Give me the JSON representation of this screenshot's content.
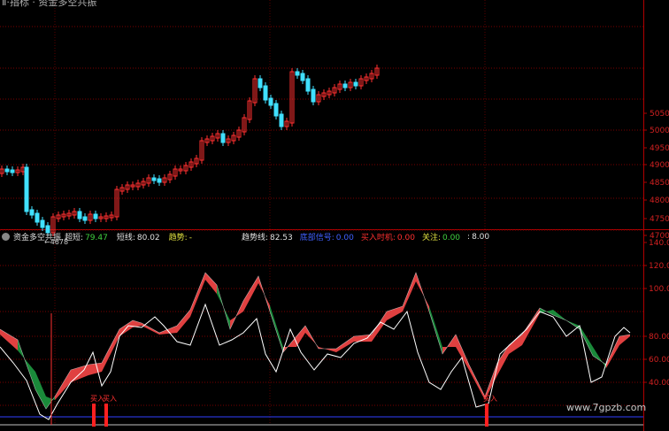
{
  "window": {
    "title": "Ⅱ·指标 · 资金多空共振"
  },
  "price_panel": {
    "y_axis": {
      "ticks": [
        "5050",
        "5000",
        "4950",
        "4900",
        "4850",
        "4800",
        "4750",
        "4700"
      ]
    },
    "low_marker": "←4678"
  },
  "indicator_panel": {
    "name": "资金多空共振",
    "items": [
      {
        "label": "超短:",
        "value": "79.47",
        "label_color": "#e0e0e0",
        "value_color": "#40d040"
      },
      {
        "label": "短线:",
        "value": "80.02",
        "label_color": "#e0e0e0",
        "value_color": "#e0e0e0"
      },
      {
        "label": "趋势:",
        "value": "-",
        "label_color": "#e0e040",
        "value_color": "#e0e040"
      },
      {
        "label": "趋势线:",
        "value": "82.53",
        "label_color": "#e0e0e0",
        "value_color": "#e0e0e0"
      },
      {
        "label": "底部信号:",
        "value": "0.00",
        "label_color": "#4060ff",
        "value_color": "#4060ff"
      },
      {
        "label": "买入时机:",
        "value": "0.00",
        "label_color": "#ff3030",
        "value_color": "#ff3030"
      },
      {
        "label": "关注:",
        "value": "0.00",
        "label_color": "#e0e040",
        "value_color": "#40d040"
      },
      {
        "label": ":",
        "value": "8.00",
        "label_color": "#e0e0e0",
        "value_color": "#e0e0e0"
      }
    ],
    "y_axis": {
      "ticks": [
        "140.00",
        "120.00",
        "100.00",
        "80.00",
        "60.00",
        "40.00"
      ]
    },
    "signals": [
      "买入",
      "买入",
      "买入"
    ]
  },
  "watermark": "www.7gpzb.com",
  "colors": {
    "up_candle": "#ff3030",
    "down_candle": "#40e0ff",
    "grid": "#7a0000",
    "bull_fill": "#e04040",
    "bear_fill": "#1a8a3a"
  }
}
